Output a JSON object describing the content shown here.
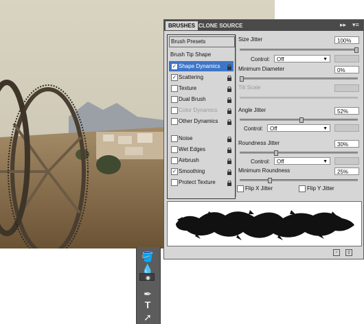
{
  "panel": {
    "tabs": [
      "BRUSHES",
      "CLONE SOURCE"
    ],
    "menu_glyphs": [
      "▸▸",
      "▾≡"
    ]
  },
  "left_list": {
    "brush_presets": "Brush Presets",
    "brush_tip_shape": "Brush Tip Shape",
    "items": [
      {
        "label": "Shape Dynamics",
        "checked": true,
        "highlighted": true,
        "dim": false
      },
      {
        "label": "Scattering",
        "checked": true,
        "highlighted": false,
        "dim": false
      },
      {
        "label": "Texture",
        "checked": false,
        "highlighted": false,
        "dim": false
      },
      {
        "label": "Dual Brush",
        "checked": false,
        "highlighted": false,
        "dim": false
      },
      {
        "label": "Color Dynamics",
        "checked": false,
        "highlighted": false,
        "dim": true
      },
      {
        "label": "Other Dynamics",
        "checked": false,
        "highlighted": false,
        "dim": false
      },
      {
        "label": "Noise",
        "checked": false,
        "highlighted": false,
        "dim": false
      },
      {
        "label": "Wet Edges",
        "checked": false,
        "highlighted": false,
        "dim": false
      },
      {
        "label": "Airbrush",
        "checked": false,
        "highlighted": false,
        "dim": false
      },
      {
        "label": "Smoothing",
        "checked": true,
        "highlighted": false,
        "dim": false
      },
      {
        "label": "Protect Texture",
        "checked": false,
        "highlighted": false,
        "dim": false
      }
    ]
  },
  "controls": {
    "size_jitter": {
      "label": "Size Jitter",
      "value": "100%",
      "level": 1.0
    },
    "control1": {
      "label": "Control:",
      "value": "Off"
    },
    "min_diameter": {
      "label": "Minimum Diameter",
      "value": "0%",
      "level": 0.0
    },
    "tilt_scale": {
      "label": "Tilt Scale"
    },
    "angle_jitter": {
      "label": "Angle Jitter",
      "value": "52%",
      "level": 0.52
    },
    "control2": {
      "label": "Control:",
      "value": "Off"
    },
    "roundness_jitter": {
      "label": "Roundness Jitter",
      "value": "30%",
      "level": 0.3
    },
    "control3": {
      "label": "Control:",
      "value": "Off"
    },
    "min_roundness": {
      "label": "Minimum Roundness",
      "value": "25%",
      "level": 0.25
    },
    "flip_x": {
      "label": "Flip X Jitter",
      "checked": false
    },
    "flip_y": {
      "label": "Flip Y Jitter",
      "checked": false
    }
  },
  "toolbar_icons": [
    "paint-bucket-icon",
    "blur-drop-icon",
    "dodge-icon",
    "pen-icon",
    "type-tool-icon",
    "path-select-icon"
  ],
  "tool_glyphs": [
    "🪣",
    "💧",
    "◉",
    "✒",
    "T",
    "➚"
  ],
  "colors": {
    "highlight": "#3d76c7",
    "panel_bg": "#d6d6d6",
    "tab_bar": "#4a4a4a"
  }
}
